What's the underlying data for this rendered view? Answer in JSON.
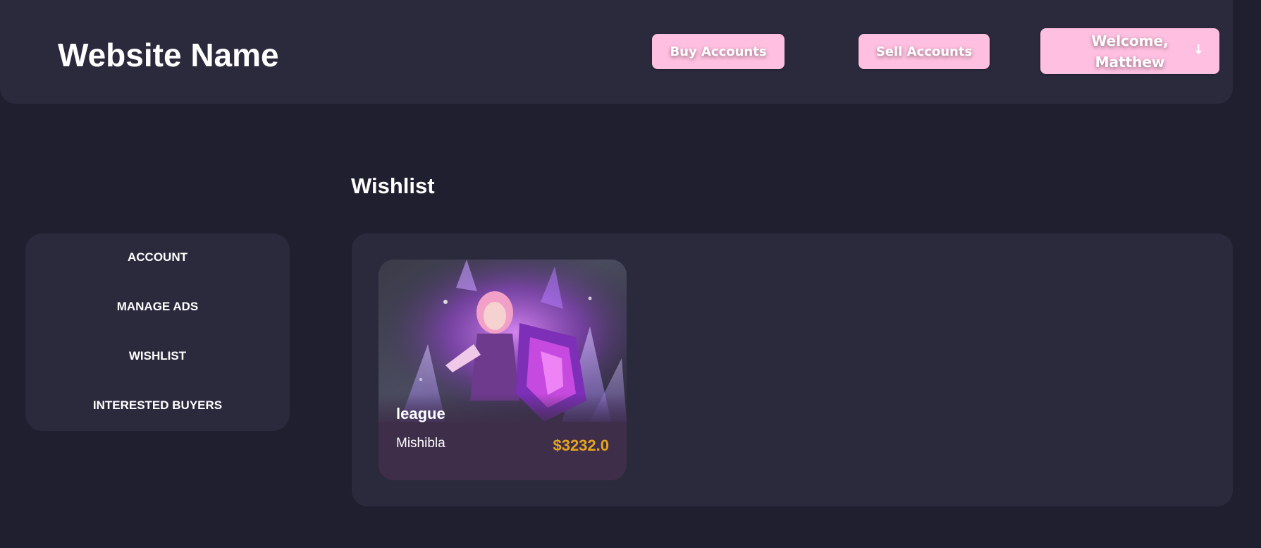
{
  "header": {
    "site_title": "Website Name",
    "buy_label": "Buy Accounts",
    "sell_label": "Sell Accounts",
    "user_label": "Welcome, Matthew",
    "user_arrow": "↓"
  },
  "sidebar": {
    "items": [
      {
        "label": "ACCOUNT"
      },
      {
        "label": "MANAGE ADS"
      },
      {
        "label": "WISHLIST"
      },
      {
        "label": "INTERESTED BUYERS"
      }
    ]
  },
  "main": {
    "title": "Wishlist",
    "cards": [
      {
        "title": "league",
        "seller": "Mishibla",
        "price": "$3232.0"
      }
    ]
  },
  "colors": {
    "page_bg": "#201f30",
    "panel_bg": "#2b2a3d",
    "button_pink": "#ffbfe0",
    "price_gold": "#e5a51d",
    "card_bottom": "#3e2e4a"
  }
}
